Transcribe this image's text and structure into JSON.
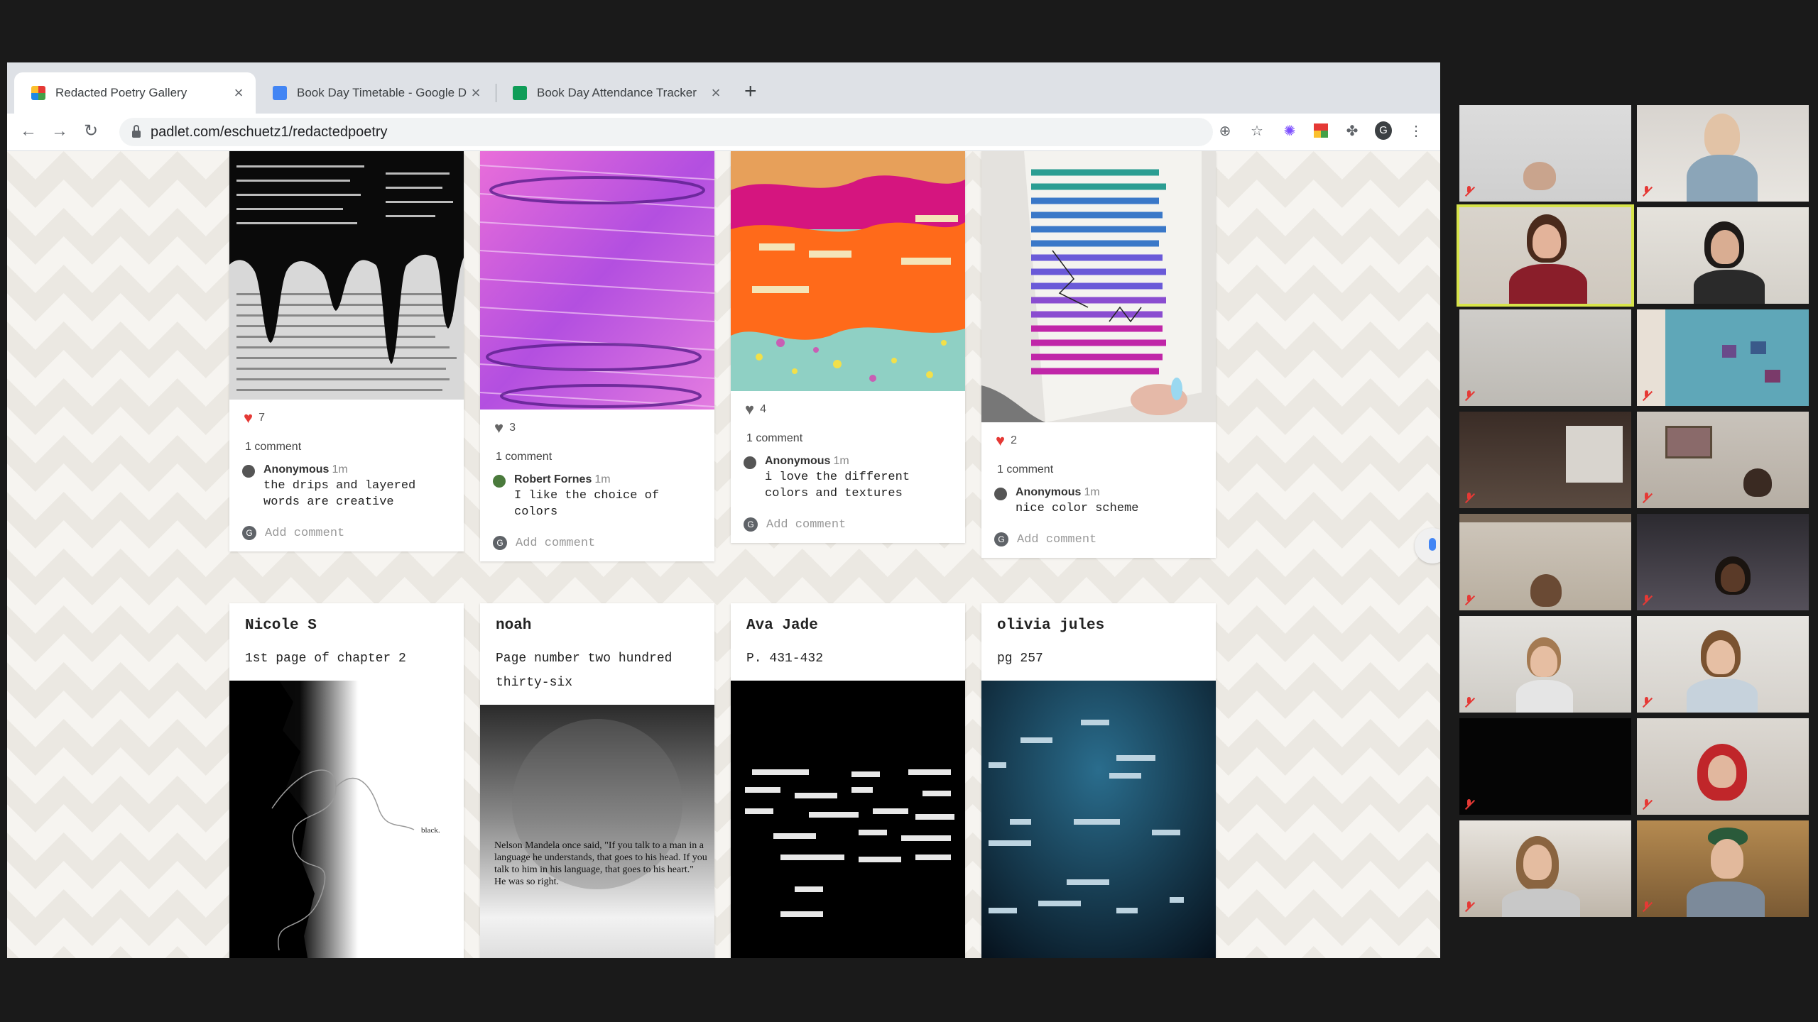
{
  "browser": {
    "tabs": [
      {
        "title": "Redacted Poetry Gallery",
        "active": true,
        "favicon": "padlet-icon"
      },
      {
        "title": "Book Day Timetable - Google D",
        "active": false,
        "favicon": "docs-icon"
      },
      {
        "title": "Book Day Attendance Tracker",
        "active": false,
        "favicon": "sheets-icon"
      }
    ],
    "new_tab": "+",
    "url": "padlet.com/eschuetz1/redactedpoetry",
    "profile_initial": "G"
  },
  "posts_top": [
    {
      "likes": "7",
      "heart": "red",
      "comment_count": "1 comment",
      "comment": {
        "author": "Anonymous",
        "time": "1m",
        "text": "the drips and layered words are creative"
      },
      "add_comment": "Add comment"
    },
    {
      "likes": "3",
      "heart": "gray",
      "comment_count": "1 comment",
      "comment": {
        "author": "Robert Fornes",
        "time": "1m",
        "text": "I like the choice of colors"
      },
      "add_comment": "Add comment"
    },
    {
      "likes": "4",
      "heart": "gray",
      "comment_count": "1 comment",
      "comment": {
        "author": "Anonymous",
        "time": "1m",
        "text": "i love the different colors and textures"
      },
      "add_comment": "Add comment"
    },
    {
      "likes": "2",
      "heart": "red",
      "comment_count": "1 comment",
      "comment": {
        "author": "Anonymous",
        "time": "1m",
        "text": "nice color scheme"
      },
      "add_comment": "Add comment"
    }
  ],
  "posts_bottom": [
    {
      "author": "Nicole S",
      "title": "1st page of chapter 2",
      "image_text": "black."
    },
    {
      "author": "noah",
      "title": "Page number two hundred thirty-six",
      "image_text": "Nelson Mandela once said, \"If you talk to a man in a language he understands, that goes to his head. If you talk to him in his language, that goes to his heart.\" He was so right."
    },
    {
      "author": "Ava Jade",
      "title": "P. 431-432"
    },
    {
      "author": "olivia jules",
      "title": "pg 257"
    }
  ],
  "fab_label": "+",
  "add_comment_initial": "G",
  "colors": {
    "fab": "#f0287a",
    "speaker_outline": "#d7e44a",
    "heart_red": "#e53935"
  }
}
